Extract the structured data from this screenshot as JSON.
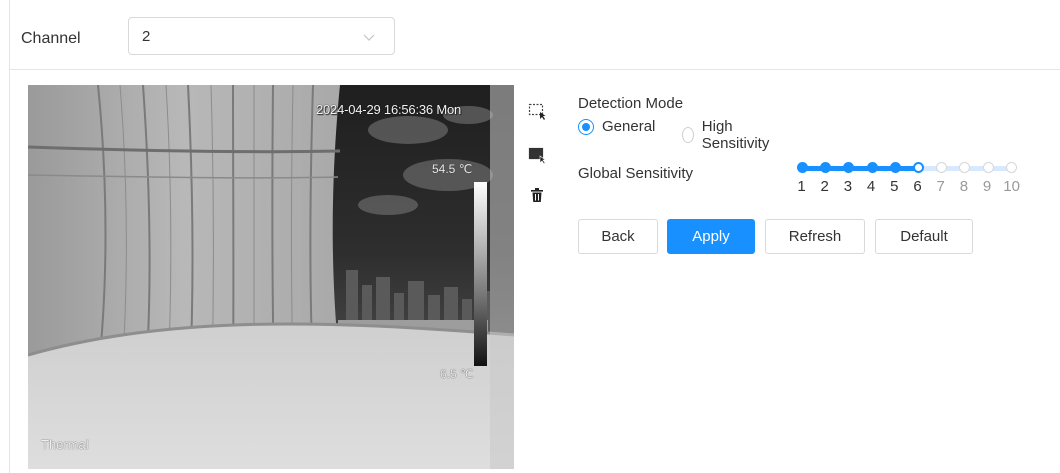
{
  "channel": {
    "label": "Channel",
    "value": "2"
  },
  "video": {
    "osd_datetime": "2024-04-29 16:56:36 Mon",
    "max_temp": "54.5 ℃",
    "min_temp": "6.5 ℃",
    "camera_label": "Thermal"
  },
  "toolbar": {
    "icons": [
      "draw-area-icon",
      "select-area-icon",
      "delete-icon"
    ]
  },
  "detection_mode": {
    "label": "Detection Mode",
    "options": [
      {
        "label": "General",
        "selected": true
      },
      {
        "label": "High Sensitivity",
        "selected": false
      }
    ]
  },
  "global_sensitivity": {
    "label": "Global Sensitivity",
    "value": 6,
    "min": 1,
    "max": 10,
    "ticks": [
      "1",
      "2",
      "3",
      "4",
      "5",
      "6",
      "7",
      "8",
      "9",
      "10"
    ]
  },
  "buttons": {
    "back": "Back",
    "apply": "Apply",
    "refresh": "Refresh",
    "default": "Default"
  },
  "colors": {
    "accent": "#1890ff",
    "inactive_track": "#d6e9ff",
    "tick_active": "#333333",
    "tick_inactive": "#999999"
  }
}
